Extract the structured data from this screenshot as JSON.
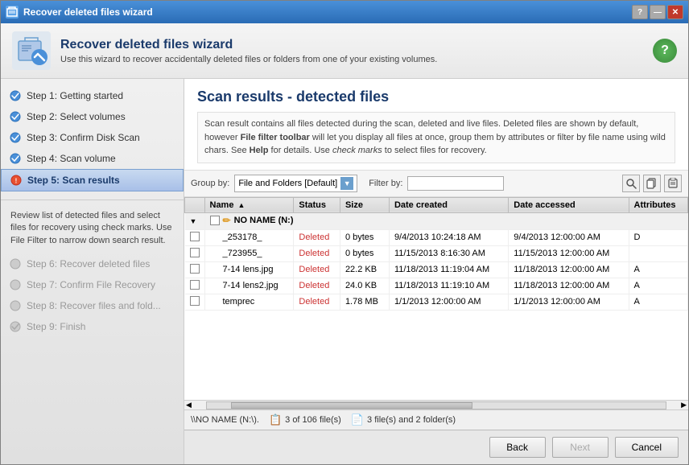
{
  "window": {
    "title": "Recover deleted files wizard",
    "titlebar_buttons": [
      "?",
      "—",
      "✕"
    ]
  },
  "header": {
    "title": "Recover deleted files wizard",
    "subtitle": "Use this wizard to recover accidentally deleted files or folders from one of your existing volumes."
  },
  "sidebar": {
    "items": [
      {
        "id": "step1",
        "label": "Step 1: Getting started",
        "state": "done"
      },
      {
        "id": "step2",
        "label": "Step 2: Select volumes",
        "state": "done"
      },
      {
        "id": "step3",
        "label": "Step 3: Confirm Disk Scan",
        "state": "done"
      },
      {
        "id": "step4",
        "label": "Step 4: Scan volume",
        "state": "done"
      },
      {
        "id": "step5",
        "label": "Step 5: Scan results",
        "state": "active"
      },
      {
        "id": "step6",
        "label": "Step 6: Recover deleted files",
        "state": "disabled"
      },
      {
        "id": "step7",
        "label": "Step 7: Confirm File Recovery",
        "state": "disabled"
      },
      {
        "id": "step8",
        "label": "Step 8: Recover files and fold...",
        "state": "disabled"
      },
      {
        "id": "step9",
        "label": "Step 9: Finish",
        "state": "disabled"
      }
    ],
    "description": "Review list of detected files and select files for recovery using check marks. Use File Filter to narrow down search result."
  },
  "main": {
    "title": "Scan results - detected files",
    "description": "Scan result contains all files detected during the scan, deleted and live files. Deleted files are shown by default, however ",
    "description_bold": "File filter toolbar",
    "description_after_bold": " will let you display all files at once, group them by attributes or filter by file name using wild chars. See ",
    "description_help": "Help",
    "description_end": " for details. Use ",
    "description_italic": "check marks",
    "description_final": " to select files for recovery.",
    "toolbar": {
      "group_by_label": "Group by:",
      "group_by_value": "File and Folders [Default]",
      "filter_by_label": "Filter by:"
    },
    "table": {
      "columns": [
        "Name",
        "Status",
        "Size",
        "Date created",
        "Date accessed",
        "Attributes"
      ],
      "group_row": "NO NAME (N:)",
      "rows": [
        {
          "name": "_253178_",
          "status": "Deleted",
          "size": "0 bytes",
          "date_created": "9/4/2013 10:24:18 AM",
          "date_accessed": "9/4/2013 12:00:00 AM",
          "attributes": "D"
        },
        {
          "name": "_723955_",
          "status": "Deleted",
          "size": "0 bytes",
          "date_created": "11/15/2013 8:16:30 AM",
          "date_accessed": "11/15/2013 12:00:00 AM",
          "attributes": ""
        },
        {
          "name": "7-14 lens.jpg",
          "status": "Deleted",
          "size": "22.2 KB",
          "date_created": "11/18/2013 11:19:04 AM",
          "date_accessed": "11/18/2013 12:00:00 AM",
          "attributes": "A"
        },
        {
          "name": "7-14 lens2.jpg",
          "status": "Deleted",
          "size": "24.0 KB",
          "date_created": "11/18/2013 11:19:10 AM",
          "date_accessed": "11/18/2013 12:00:00 AM",
          "attributes": "A"
        },
        {
          "name": "temprec",
          "status": "Deleted",
          "size": "1.78 MB",
          "date_created": "1/1/2013 12:00:00 AM",
          "date_accessed": "1/1/2013 12:00:00 AM",
          "attributes": "A"
        }
      ]
    },
    "status_bar": {
      "path": "\\\\NO NAME (N:\\).",
      "files_label": "3 of 106 file(s)",
      "folders_label": "3 file(s) and 2 folder(s)"
    },
    "buttons": {
      "back": "Back",
      "next": "Next",
      "cancel": "Cancel"
    }
  }
}
